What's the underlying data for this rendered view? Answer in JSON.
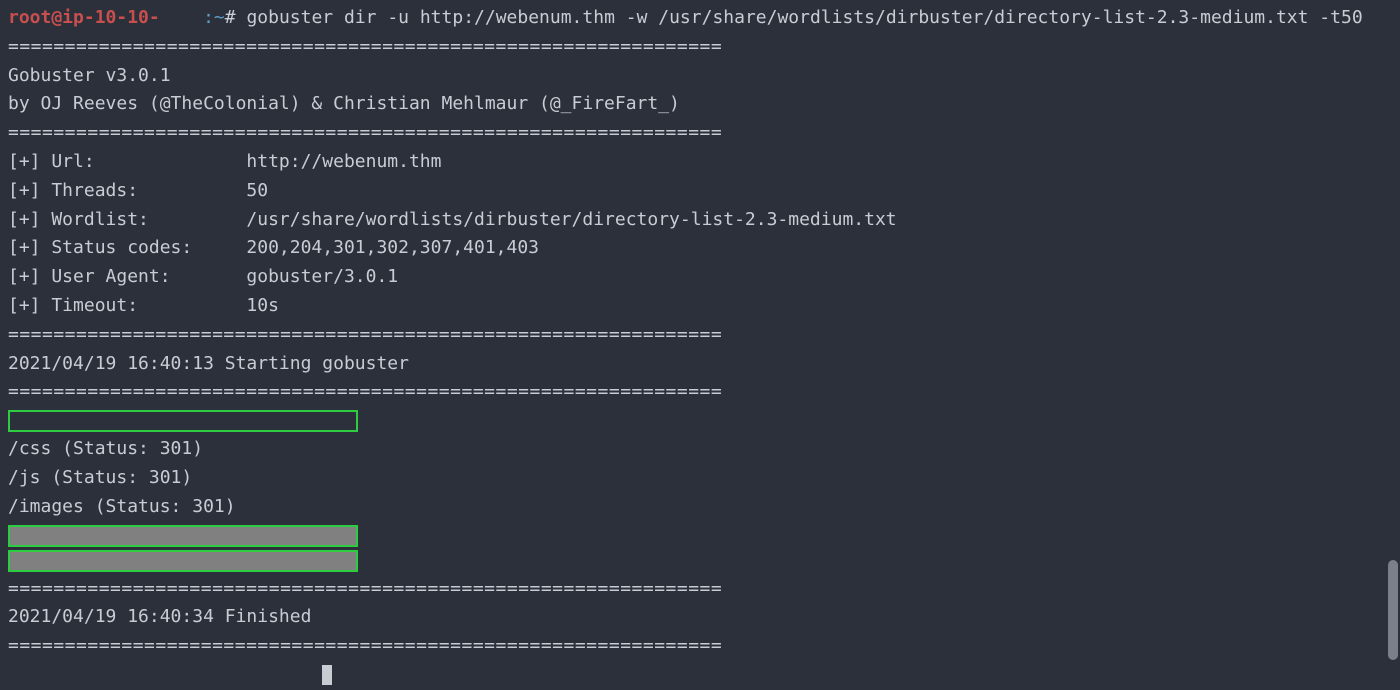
{
  "prompt": {
    "user_host": "root@ip-10-10-",
    "sep1": ":",
    "path": "~",
    "sep2": "# ",
    "command": "gobuster dir -u http://webenum.thm -w /usr/share/wordlists/dirbuster/directory-list-2.3-medium.txt -t50"
  },
  "banner": {
    "divider": "===============================================================",
    "title": "Gobuster v3.0.1",
    "by": "by OJ Reeves (@TheColonial) & Christian Mehlmaur (@_FireFart_)"
  },
  "config": {
    "lines": [
      {
        "label": "[+] Url:",
        "value": "http://webenum.thm"
      },
      {
        "label": "[+] Threads:",
        "value": "50"
      },
      {
        "label": "[+] Wordlist:",
        "value": "/usr/share/wordlists/dirbuster/directory-list-2.3-medium.txt"
      },
      {
        "label": "[+] Status codes:",
        "value": "200,204,301,302,307,401,403"
      },
      {
        "label": "[+] User Agent:",
        "value": "gobuster/3.0.1"
      },
      {
        "label": "[+] Timeout:",
        "value": "10s"
      }
    ]
  },
  "start_line": "2021/04/19 16:40:13 Starting gobuster",
  "results": [
    "/css (Status: 301)",
    "/js (Status: 301)",
    "/images (Status: 301)"
  ],
  "finish_line": "2021/04/19 16:40:34 Finished"
}
